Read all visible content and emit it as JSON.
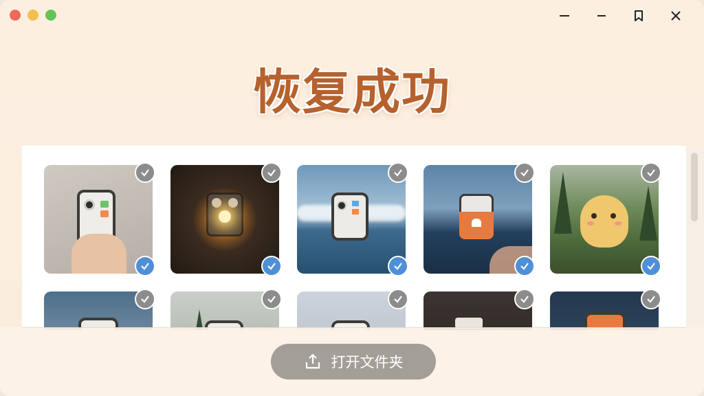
{
  "window": {
    "traffic_colors": [
      "#ec6a5e",
      "#f4bf4f",
      "#61c554"
    ],
    "controls": [
      "minimize-icon",
      "minimize-icon",
      "bookmark-icon",
      "close-icon"
    ]
  },
  "title": "恢复成功",
  "accent_color": "#b5622e",
  "check_color": "#4f8fd6",
  "photos": [
    {
      "scene": "hand-holding-device",
      "selected": true
    },
    {
      "scene": "dark-sparkle-device",
      "selected": true
    },
    {
      "scene": "sea-clouds-device",
      "selected": true
    },
    {
      "scene": "heart-device-lake",
      "selected": true
    },
    {
      "scene": "yellow-character-forest",
      "selected": true
    },
    {
      "scene": "sea-device",
      "selected": null
    },
    {
      "scene": "forest-device",
      "selected": null
    },
    {
      "scene": "foggy-device",
      "selected": null
    },
    {
      "scene": "dark-device",
      "selected": null
    },
    {
      "scene": "orange-device",
      "selected": null
    }
  ],
  "open_folder_button": {
    "label": "打开文件夹",
    "icon": "upload-icon"
  }
}
